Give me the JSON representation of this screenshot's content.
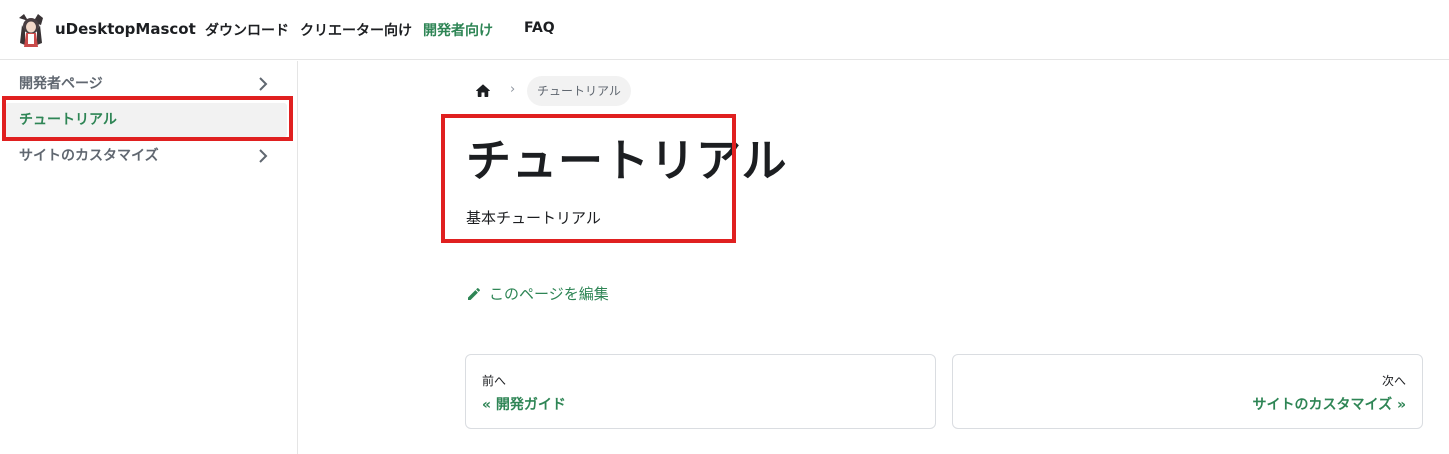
{
  "navbar": {
    "brand": "uDesktopMascot",
    "items": [
      {
        "label": "ダウンロード",
        "active": false
      },
      {
        "label": "クリエーター向け",
        "active": false
      },
      {
        "label": "開発者向け",
        "active": true
      },
      {
        "label": "FAQ",
        "active": false
      }
    ]
  },
  "sidebar": {
    "items": [
      {
        "label": "開発者ページ",
        "has_children": true,
        "active": false
      },
      {
        "label": "チュートリアル",
        "has_children": false,
        "active": true
      },
      {
        "label": "サイトのカスタマイズ",
        "has_children": true,
        "active": false
      }
    ]
  },
  "breadcrumb": {
    "home_icon": "home-icon",
    "separator": "›",
    "current": "チュートリアル"
  },
  "page": {
    "title": "チュートリアル",
    "description": "基本チュートリアル",
    "edit_label": "このページを編集"
  },
  "pagination": {
    "prev": {
      "sub": "前へ",
      "label": "« 開発ガイド"
    },
    "next": {
      "sub": "次へ",
      "label": "サイトのカスタマイズ »"
    }
  },
  "colors": {
    "accent": "#2e8555",
    "highlight": "#e02020",
    "text": "#1c1e21",
    "muted": "#606770"
  }
}
